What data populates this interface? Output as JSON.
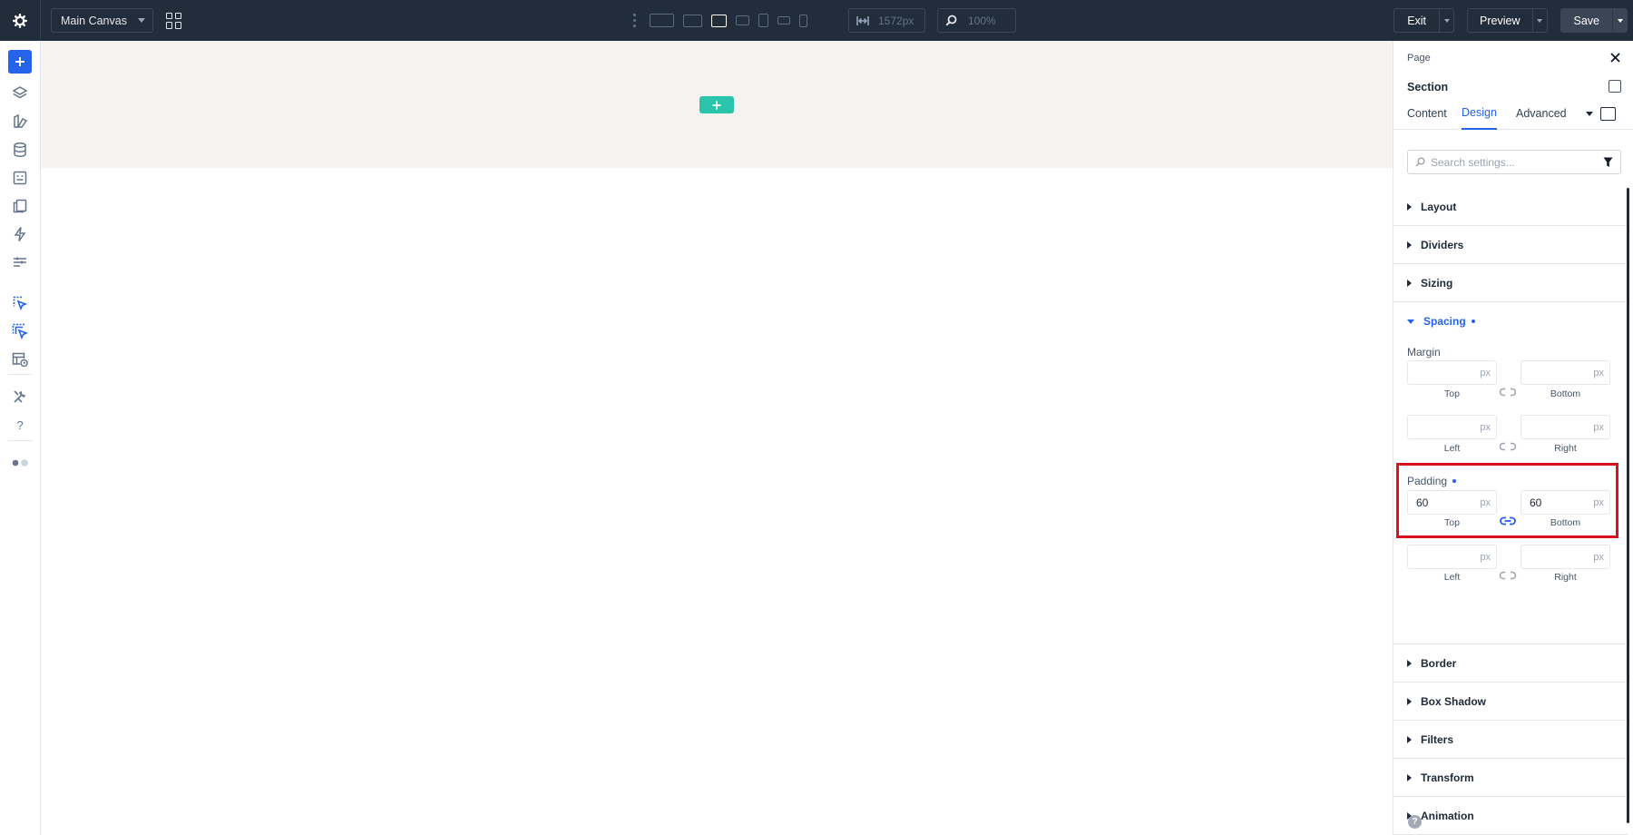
{
  "topbar": {
    "canvas_name": "Main Canvas",
    "width_value": "1572px",
    "zoom_value": "100%",
    "exit_label": "Exit",
    "preview_label": "Preview",
    "save_label": "Save",
    "device_icons": [
      "desktop-wide-icon",
      "desktop-icon",
      "laptop-icon",
      "tablet-landscape-icon",
      "tablet-portrait-icon",
      "phone-landscape-icon",
      "phone-portrait-icon"
    ],
    "active_device": "laptop-icon"
  },
  "rail": {
    "icons": [
      "add-icon",
      "layers-icon",
      "theme-builder-icon",
      "database-icon",
      "forms-icon",
      "pages-icon",
      "lightning-icon",
      "settings-sliders-icon",
      "page-cursor-icon",
      "pages-cursor-icon",
      "layout-clock-icon",
      "tools-icon",
      "help-icon",
      "toggle-dots-icon"
    ]
  },
  "colors": {
    "topbar_bg": "#222d3b",
    "accent_blue": "#2563eb",
    "add_section_green": "#29c4a9",
    "canvas_section_bg": "#f4f3ef",
    "highlight_red": "#d9121d"
  },
  "panel": {
    "breadcrumb": "Page",
    "title": "Section",
    "tabs": [
      {
        "label": "Content",
        "active": false
      },
      {
        "label": "Design",
        "active": true
      },
      {
        "label": "Advanced",
        "active": false
      }
    ],
    "search_placeholder": "Search settings...",
    "groups_before": [
      {
        "label": "Layout"
      },
      {
        "label": "Dividers"
      },
      {
        "label": "Sizing"
      }
    ],
    "spacing": {
      "label": "Spacing",
      "margin": {
        "label": "Margin",
        "top": {
          "value": "",
          "unit": "px",
          "caption": "Top"
        },
        "bottom": {
          "value": "",
          "unit": "px",
          "caption": "Bottom"
        },
        "left": {
          "value": "",
          "unit": "px",
          "caption": "Left"
        },
        "right": {
          "value": "",
          "unit": "px",
          "caption": "Right"
        }
      },
      "padding": {
        "label": "Padding",
        "top": {
          "value": "60",
          "unit": "px",
          "caption": "Top"
        },
        "bottom": {
          "value": "60",
          "unit": "px",
          "caption": "Bottom"
        },
        "left": {
          "value": "",
          "unit": "px",
          "caption": "Left"
        },
        "right": {
          "value": "",
          "unit": "px",
          "caption": "Right"
        }
      }
    },
    "groups_after": [
      {
        "label": "Border"
      },
      {
        "label": "Box Shadow"
      },
      {
        "label": "Filters"
      },
      {
        "label": "Transform"
      },
      {
        "label": "Animation"
      }
    ],
    "help_glyph": "?"
  }
}
